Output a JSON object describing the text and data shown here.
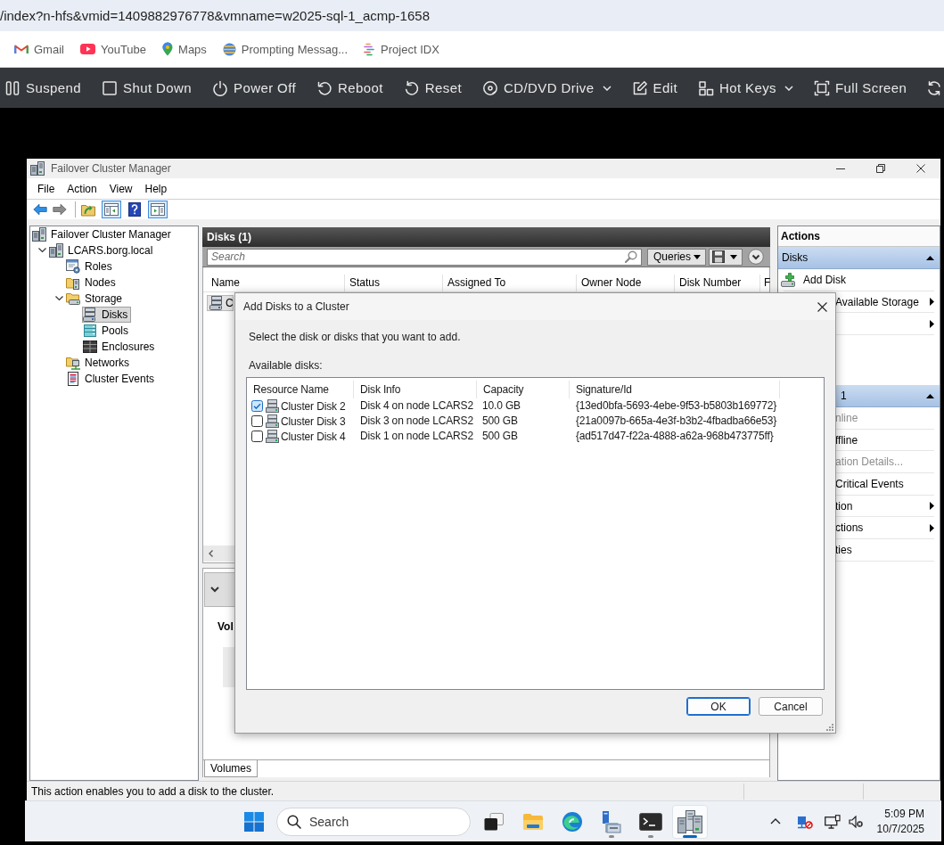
{
  "browser": {
    "url": "/index?n-hfs&vmid=1409882976778&vmname=w2025-sql-1_acmp-1658",
    "bookmarks": [
      {
        "kind": "mail",
        "label": "Gmail"
      },
      {
        "kind": "video",
        "label": "YouTube"
      },
      {
        "kind": "pin",
        "label": "Maps"
      },
      {
        "kind": "globe",
        "label": "Prompting Messag..."
      },
      {
        "kind": "lines",
        "label": "Project IDX"
      }
    ]
  },
  "vm_toolbar": [
    {
      "kind": "pause",
      "label": "Suspend",
      "dropdown": false
    },
    {
      "kind": "stop",
      "label": "Shut Down",
      "dropdown": false
    },
    {
      "kind": "power",
      "label": "Power Off",
      "dropdown": false
    },
    {
      "kind": "reboot",
      "label": "Reboot",
      "dropdown": false
    },
    {
      "kind": "reset",
      "label": "Reset",
      "dropdown": false
    },
    {
      "kind": "disc",
      "label": "CD/DVD Drive",
      "dropdown": true
    },
    {
      "kind": "edit",
      "label": "Edit",
      "dropdown": false
    },
    {
      "kind": "keys",
      "label": "Hot Keys",
      "dropdown": true
    },
    {
      "kind": "fullscreen",
      "label": "Full Screen",
      "dropdown": false
    },
    {
      "kind": "refresh",
      "dropdown": false
    }
  ],
  "window": {
    "title": "Failover Cluster Manager",
    "menu": [
      "File",
      "Action",
      "View",
      "Help"
    ],
    "toolbar": [
      [
        {
          "kind": "back",
          "pressed": false
        },
        {
          "kind": "forward",
          "pressed": false
        }
      ],
      [
        {
          "kind": "up",
          "pressed": false
        },
        {
          "kind": "tree",
          "pressed": true
        },
        {
          "kind": "help",
          "pressed": false
        },
        {
          "kind": "pane",
          "pressed": true
        }
      ]
    ],
    "tree": [
      {
        "kind": "cluster",
        "label": "Failover Cluster Manager",
        "selected": false,
        "children": [
          {
            "kind": "cluster",
            "label": "LCARS.borg.local",
            "expanded": true,
            "selected": false,
            "children": [
              {
                "kind": "roles",
                "label": "Roles",
                "selected": false
              },
              {
                "kind": "nodes",
                "label": "Nodes",
                "selected": false
              },
              {
                "kind": "storage",
                "label": "Storage",
                "expanded": true,
                "selected": false,
                "children": [
                  {
                    "kind": "disks",
                    "label": "Disks",
                    "selected": true
                  },
                  {
                    "kind": "pools",
                    "label": "Pools",
                    "selected": false
                  },
                  {
                    "kind": "enclosures",
                    "label": "Enclosures",
                    "selected": false
                  }
                ]
              },
              {
                "kind": "networks",
                "label": "Networks",
                "selected": false
              },
              {
                "kind": "events",
                "label": "Cluster Events",
                "selected": false
              }
            ]
          }
        ]
      }
    ],
    "center": {
      "title": "Disks (1)",
      "search": {
        "placeholder": "Search"
      },
      "queries": "Queries",
      "columns": [
        "Name",
        "Status",
        "Assigned To",
        "Owner Node",
        "Disk Number",
        "F"
      ],
      "rows": [
        {
          "name": "C",
          "selected": true
        }
      ],
      "details": {
        "heading": "Vol",
        "tabs": [
          {
            "label": "Volumes",
            "selected": true
          }
        ]
      }
    },
    "actions": {
      "title": "Actions",
      "sections": [
        {
          "kind": "full",
          "title": "Disks",
          "expanded": true,
          "items": [
            {
              "kind": "adddisk",
              "label": "Add Disk",
              "disabled": false,
              "submenu": false
            },
            {
              "kind": "clipped",
              "label": "Available Storage",
              "disabled": false,
              "submenu": true
            },
            {
              "kind": "clipped",
              "submenu": true
            }
          ]
        },
        {
          "kind": "clipped",
          "title": "1",
          "expanded": true,
          "items": [
            {
              "kind": "clipped",
              "label": "nline",
              "disabled": true,
              "submenu": false
            },
            {
              "kind": "clipped",
              "label": "ffline",
              "disabled": false,
              "submenu": false
            },
            {
              "kind": "clipped",
              "label": "ation Details...",
              "disabled": true,
              "submenu": false
            },
            {
              "kind": "clipped",
              "label": "Critical Events",
              "disabled": false,
              "submenu": false
            },
            {
              "kind": "clipped",
              "label": "tion",
              "disabled": false,
              "submenu": true
            },
            {
              "kind": "clipped",
              "label": "ctions",
              "disabled": false,
              "submenu": true
            },
            {
              "kind": "clipped",
              "label": "ties",
              "disabled": false,
              "submenu": false
            }
          ]
        }
      ]
    },
    "dialog": {
      "title": "Add Disks to a Cluster",
      "instruction": "Select the disk or disks that you want to add.",
      "list_label": "Available disks:",
      "columns": [
        "Resource Name",
        "Disk Info",
        "Capacity",
        "Signature/Id"
      ],
      "rows": [
        {
          "checked": true,
          "name": "Cluster Disk 2",
          "info": "Disk 4 on node LCARS2",
          "capacity": "10.0 GB",
          "signature": "{13ed0bfa-5693-4ebe-9f53-b5803b169772}"
        },
        {
          "checked": false,
          "name": "Cluster Disk 3",
          "info": "Disk 3 on node LCARS2",
          "capacity": "500 GB",
          "signature": "{21a0097b-665a-4e3f-b3b2-4fbadba66e53}"
        },
        {
          "checked": false,
          "name": "Cluster Disk 4",
          "info": "Disk 1 on node LCARS2",
          "capacity": "500 GB",
          "signature": "{ad517d47-f22a-4888-a62a-968b473775ff}"
        }
      ],
      "buttons": [
        {
          "label": "OK",
          "default": true
        },
        {
          "label": "Cancel",
          "default": false
        }
      ]
    },
    "status_bar": "This action enables you to add a disk to the cluster."
  },
  "taskbar": {
    "search": {
      "placeholder": "Search"
    },
    "apps": [
      {
        "kind": "taskview",
        "running": false,
        "selected": false
      },
      {
        "kind": "explorer",
        "running": false,
        "selected": false
      },
      {
        "kind": "browser",
        "running": false,
        "selected": false
      },
      {
        "kind": "servermanager",
        "running": true,
        "selected": false
      },
      {
        "kind": "terminal",
        "running": true,
        "selected": false
      },
      {
        "kind": "cluster",
        "running": true,
        "selected": true
      }
    ],
    "tray": {
      "icons": [
        {
          "kind": "chevron"
        },
        {
          "kind": "network"
        },
        {
          "kind": "display"
        },
        {
          "kind": "muted"
        }
      ],
      "time": "5:09 PM",
      "date": "10/7/2025"
    }
  }
}
